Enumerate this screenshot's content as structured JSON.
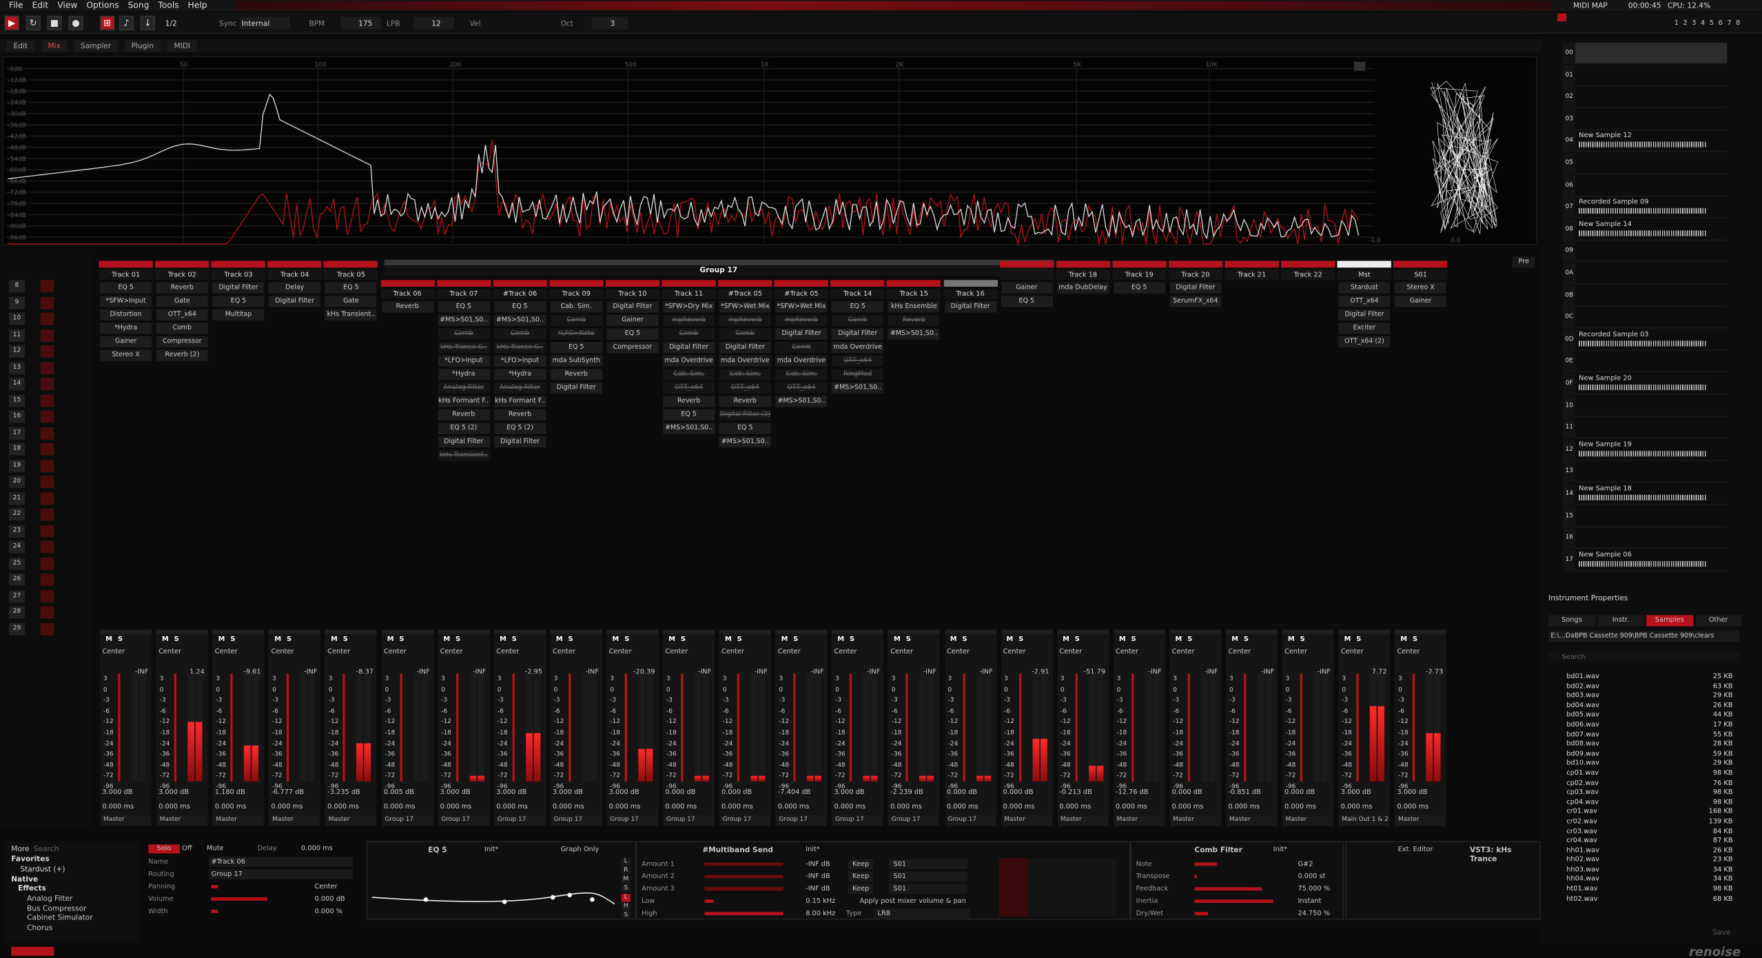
{
  "menu": [
    "File",
    "Edit",
    "View",
    "Options",
    "Song",
    "Tools",
    "Help"
  ],
  "top": {
    "pattern": "1/2",
    "sync_label": "Sync",
    "sync_value": "Internal",
    "bpm_label": "BPM",
    "bpm": "175",
    "lpb_label": "LPB",
    "lpb": "12",
    "vel_label": "Vel",
    "oct_label": "Oct",
    "oct": "3",
    "midi_map": "MIDI MAP",
    "time": "00:00:45",
    "cpu": "CPU: 12.4%",
    "tracks_vis": [
      "1",
      "2",
      "3",
      "4",
      "5",
      "6",
      "7",
      "8"
    ]
  },
  "tabs": [
    "Edit",
    "Mix",
    "Sampler",
    "Plugin",
    "MIDI"
  ],
  "spectrum": {
    "freq_labels": [
      "50",
      "100",
      "200",
      "500",
      "1K",
      "2K",
      "5K",
      "10K"
    ],
    "db_labels": [
      "-6dB",
      "-12dB",
      "-18dB",
      "-24dB",
      "-30dB",
      "-36dB",
      "-42dB",
      "-48dB",
      "-54dB",
      "-60dB",
      "-66dB",
      "-72dB",
      "-78dB",
      "-84dB",
      "-90dB",
      "-96dB"
    ],
    "scope_l": "-1.0",
    "scope_r": "0.0"
  },
  "seq": [
    "8",
    "9",
    "10",
    "11",
    "12",
    "13",
    "14",
    "15",
    "16",
    "17",
    "18",
    "19",
    "20",
    "21",
    "22",
    "23",
    "24",
    "25",
    "26",
    "27",
    "28",
    "29"
  ],
  "channels": [
    {
      "name": "Track 01",
      "devices": [
        "EQ 5",
        "*SFW>Input",
        "Distortion",
        "*Hydra",
        "Gainer",
        "Stereo X"
      ],
      "pan": "Center",
      "peak": "-INF",
      "db": "3.000 dB",
      "delay": "0.000 ms",
      "route": "Master"
    },
    {
      "name": "Track 02",
      "devices": [
        "Reverb",
        "Gate",
        "OTT_x64",
        "Comb",
        "Compressor",
        "Reverb (2)"
      ],
      "pan": "Center",
      "peak": "1.24",
      "db": "3.000 dB",
      "delay": "0.000 ms",
      "route": "Master"
    },
    {
      "name": "Track 03",
      "devices": [
        "Digital Filter",
        "EQ 5",
        "Multitap"
      ],
      "pan": "Center",
      "peak": "-9.61",
      "db": "1.180 dB",
      "delay": "0.000 ms",
      "route": "Master"
    },
    {
      "name": "Track 04",
      "devices": [
        "Delay",
        "Digital Filter"
      ],
      "pan": "Center",
      "peak": "-INF",
      "db": "-6.777 dB",
      "delay": "0.000 ms",
      "route": "Master"
    },
    {
      "name": "Track 05",
      "devices": [
        "EQ 5",
        "Gate",
        "kHs Transient.."
      ],
      "pan": "Center",
      "peak": "-8.37",
      "db": "-3.235 dB",
      "delay": "0.000 ms",
      "route": "Master"
    },
    {
      "name": "Track 06",
      "devices": [
        "Reverb"
      ],
      "pan": "Center",
      "peak": "-INF",
      "db": "0.005 dB",
      "delay": "0.000 ms",
      "route": "Group 17"
    },
    {
      "name": "Track 07",
      "devices": [
        "EQ 5",
        "#MS>S01,S0..",
        "Comb",
        "kHs Trance G..",
        "*LFO>Input",
        "*Hydra",
        "Analog Filter",
        "kHs Formant F..",
        "Reverb",
        "EQ 5 (2)",
        "Digital Filter",
        "kHs Transient.."
      ],
      "pan": "Center",
      "peak": "-INF",
      "db": "3.000 dB",
      "delay": "0.000 ms",
      "route": "Group 17"
    },
    {
      "name": "#Track 06",
      "devices": [
        "EQ 5",
        "#MS>S01,S0..",
        "Comb",
        "kHs Trance G..",
        "*LFO>Input",
        "*Hydra",
        "Analog Filter",
        "kHs Formant F..",
        "Reverb",
        "EQ 5 (2)",
        "Digital Filter"
      ],
      "pan": "Center",
      "peak": "-2.95",
      "db": "3.000 dB",
      "delay": "0.000 ms",
      "route": "Group 17"
    },
    {
      "name": "Track 09",
      "devices": [
        "Cab. Sim.",
        "Comb",
        "*LFO>Note",
        "EQ 5",
        "mda SubSynth",
        "Reverb",
        "Digital Filter"
      ],
      "pan": "Center",
      "peak": "-INF",
      "db": "3.000 dB",
      "delay": "0.000 ms",
      "route": "Group 17"
    },
    {
      "name": "Track 10",
      "devices": [
        "Digital Filter",
        "Gainer",
        "EQ 5",
        "Compressor"
      ],
      "pan": "Center",
      "peak": "-20.39",
      "db": "3.000 dB",
      "delay": "0.000 ms",
      "route": "Group 17"
    },
    {
      "name": "Track 11",
      "devices": [
        "*SFW>Dry Mix",
        "mpReverb",
        "Comb",
        "Digital Filter",
        "mda Overdrive",
        "Cab. Sim.",
        "OTT_x64",
        "Reverb",
        "EQ 5",
        "#MS>S01,S0.."
      ],
      "pan": "Center",
      "peak": "-INF",
      "db": "0.000 dB",
      "delay": "0.000 ms",
      "route": "Group 17"
    },
    {
      "name": "#Track 05",
      "devices": [
        "*SFW>Wet Mix",
        "mpReverb",
        "Comb",
        "Digital Filter",
        "mda Overdrive",
        "Cab. Sim.",
        "OTT_x64",
        "Reverb",
        "Digital Filter (2)",
        "EQ 5",
        "#MS>S01,S0.."
      ],
      "pan": "Center",
      "peak": "-INF",
      "db": "0.000 dB",
      "delay": "0.000 ms",
      "route": "Group 17"
    },
    {
      "name": "#Track 05",
      "devices": [
        "*SFW>Wet Mix",
        "mpReverb",
        "Digital Filter",
        "Comb",
        "mda Overdrive",
        "Cab. Sim.",
        "OTT_x64",
        "#MS>S01,S0.."
      ],
      "pan": "Center",
      "peak": "-INF",
      "db": "-7.404 dB",
      "delay": "0.000 ms",
      "route": "Group 17"
    },
    {
      "name": "Track 14",
      "devices": [
        "EQ 5",
        "Comb",
        "Digital Filter",
        "mda Overdrive",
        "OTT_x64",
        "RingMod",
        "#MS>S01,S0.."
      ],
      "pan": "Center",
      "peak": "-INF",
      "db": "3.000 dB",
      "delay": "0.000 ms",
      "route": "Group 17"
    },
    {
      "name": "Track 15",
      "devices": [
        "kHs Ensemble",
        "Reverb",
        "#MS>S01,S0.."
      ],
      "pan": "Center",
      "peak": "-INF",
      "db": "-2.239 dB",
      "delay": "0.000 ms",
      "route": "Group 17"
    },
    {
      "name": "Track 16",
      "devices": [
        "Digital Filter"
      ],
      "pan": "Center",
      "peak": "-INF",
      "db": "0.000 dB",
      "delay": "0.000 ms",
      "route": "Group 17"
    },
    {
      "name": "",
      "devices": [
        "Gainer",
        "EQ 5"
      ],
      "pan": "Center",
      "peak": "-2.91",
      "db": "0.000 dB",
      "delay": "0.000 ms",
      "route": "Master"
    },
    {
      "name": "Track 18",
      "devices": [
        "mda DubDelay"
      ],
      "pan": "Center",
      "peak": "-51.79",
      "db": "-0.213 dB",
      "delay": "0.000 ms",
      "route": "Master"
    },
    {
      "name": "Track 19",
      "devices": [
        "EQ 5"
      ],
      "pan": "Center",
      "peak": "-INF",
      "db": "-12.76 dB",
      "delay": "0.000 ms",
      "route": "Master"
    },
    {
      "name": "Track 20",
      "devices": [
        "Digital Filter",
        "SerumFX_x64"
      ],
      "pan": "Center",
      "peak": "-INF",
      "db": "0.000 dB",
      "delay": "0.000 ms",
      "route": "Master"
    },
    {
      "name": "Track 21",
      "devices": [],
      "pan": "Center",
      "peak": "-INF",
      "db": "-0.851 dB",
      "delay": "0.000 ms",
      "route": "Master"
    },
    {
      "name": "Track 22",
      "devices": [],
      "pan": "Center",
      "peak": "-INF",
      "db": "0.000 dB",
      "delay": "0.000 ms",
      "route": "Master"
    },
    {
      "name": "Mst",
      "devices": [
        "Stardust",
        "OTT_x64",
        "Digital Filter",
        "Exciter",
        "OTT_x64 (2)"
      ],
      "pan": "Center",
      "peak": "7.72",
      "db": "3.000 dB",
      "delay": "0.000 ms",
      "route": "Main Out 1 & 2"
    },
    {
      "name": "S01",
      "devices": [
        "Stereo X",
        "Gainer"
      ],
      "pan": "Center",
      "peak": "-2.73",
      "db": "3.000 dB",
      "delay": "0.000 ms",
      "route": "Master"
    }
  ],
  "group_label": "Group 17",
  "meter_scale": [
    "3",
    "0",
    "-3",
    "-6",
    "-12",
    "-18",
    "-24",
    "-36",
    "-48",
    "-72",
    "-96"
  ],
  "pre_label": "Pre",
  "instruments": [
    {
      "num": "00",
      "name": ""
    },
    {
      "num": "01",
      "name": ""
    },
    {
      "num": "02",
      "name": ""
    },
    {
      "num": "03",
      "name": ""
    },
    {
      "num": "04",
      "name": "New Sample 12"
    },
    {
      "num": "05",
      "name": ""
    },
    {
      "num": "06",
      "name": ""
    },
    {
      "num": "07",
      "name": "Recorded Sample 09"
    },
    {
      "num": "08",
      "name": "New Sample 14"
    },
    {
      "num": "09",
      "name": ""
    },
    {
      "num": "0A",
      "name": ""
    },
    {
      "num": "0B",
      "name": ""
    },
    {
      "num": "0C",
      "name": ""
    },
    {
      "num": "0D",
      "name": "Recorded Sample 03"
    },
    {
      "num": "0E",
      "name": ""
    },
    {
      "num": "0F",
      "name": "New Sample 20"
    },
    {
      "num": "10",
      "name": ""
    },
    {
      "num": "11",
      "name": ""
    },
    {
      "num": "12",
      "name": "New Sample 19"
    },
    {
      "num": "13",
      "name": ""
    },
    {
      "num": "14",
      "name": "New Sample 18"
    },
    {
      "num": "15",
      "name": ""
    },
    {
      "num": "16",
      "name": ""
    },
    {
      "num": "17",
      "name": "New Sample 06"
    }
  ],
  "inst_props": "Instrument Properties",
  "browser": {
    "tabs": [
      "Songs",
      "Instr.",
      "Samples",
      "Other"
    ],
    "path": "E:\\...DaBPB Cassette 909\\BPB Cassette 909\\clears",
    "search_placeholder": "Search",
    "files": [
      [
        "bd01.wav",
        "25 KB"
      ],
      [
        "bd02.wav",
        "63 KB"
      ],
      [
        "bd03.wav",
        "29 KB"
      ],
      [
        "bd04.wav",
        "26 KB"
      ],
      [
        "bd05.wav",
        "44 KB"
      ],
      [
        "bd06.wav",
        "17 KB"
      ],
      [
        "bd07.wav",
        "55 KB"
      ],
      [
        "bd08.wav",
        "28 KB"
      ],
      [
        "bd09.wav",
        "59 KB"
      ],
      [
        "bd10.wav",
        "29 KB"
      ],
      [
        "cp01.wav",
        "98 KB"
      ],
      [
        "cp02.wav",
        "76 KB"
      ],
      [
        "cp03.wav",
        "98 KB"
      ],
      [
        "cp04.wav",
        "98 KB"
      ],
      [
        "cr01.wav",
        "168 KB"
      ],
      [
        "cr02.wav",
        "139 KB"
      ],
      [
        "cr03.wav",
        "84 KB"
      ],
      [
        "cr04.wav",
        "87 KB"
      ],
      [
        "hh01.wav",
        "26 KB"
      ],
      [
        "hh02.wav",
        "23 KB"
      ],
      [
        "hh03.wav",
        "34 KB"
      ],
      [
        "hh04.wav",
        "34 KB"
      ],
      [
        "ht01.wav",
        "98 KB"
      ],
      [
        "ht02.wav",
        "68 KB"
      ]
    ],
    "save": "Save"
  },
  "bottom": {
    "more": "More",
    "search": "Search",
    "favorites": "Favorites",
    "fav_item": "Stardust (+)",
    "native": "Native",
    "effects": "Effects",
    "effect_items": [
      "Analog Filter",
      "Bus Compressor",
      "Cabinet Simulator",
      "Chorus"
    ],
    "track": {
      "solo": "Solo",
      "off": "Off",
      "mute": "Mute",
      "delay_label": "Delay",
      "delay": "0.000 ms",
      "name_label": "Name",
      "name": "#Track 06",
      "routing_label": "Routing",
      "routing": "Group 17",
      "panning_label": "Panning",
      "panning": "Center",
      "volume_label": "Volume",
      "volume": "0.000 dB",
      "width_label": "Width",
      "width": "0.000 %"
    },
    "eq": {
      "title": "EQ 5",
      "preset": "Init*",
      "mode": "Graph Only",
      "buttons": [
        "L",
        "R",
        "M",
        "S",
        "L",
        "H",
        "S"
      ],
      "ticks": [
        "100",
        "1K",
        "10K"
      ]
    },
    "ms": {
      "title": "#Multiband Send",
      "preset": "Init*",
      "rows": [
        [
          "Amount 1",
          "-INF dB",
          "Keep",
          "S01"
        ],
        [
          "Amount 2",
          "-INF dB",
          "Keep",
          "S01"
        ],
        [
          "Amount 3",
          "-INF dB",
          "Keep",
          "S01"
        ],
        [
          "Low",
          "0.15 kHz",
          "",
          ""
        ],
        [
          "High",
          "8.00 kHz",
          "",
          ""
        ]
      ],
      "apply": "Apply post mixer volume & pan",
      "type_label": "Type",
      "type": "LR8",
      "ticks": [
        "100",
        "1K",
        "10K"
      ]
    },
    "comb": {
      "title": "Comb Filter",
      "preset": "Init*",
      "rows": [
        [
          "Note",
          "G#2"
        ],
        [
          "Transpose",
          "0.000 st"
        ],
        [
          "Feedback",
          "75.000 %"
        ],
        [
          "Inertia",
          "Instant"
        ],
        [
          "Dry/Wet",
          "24.750 %"
        ]
      ]
    },
    "vst": {
      "ext": "Ext. Editor",
      "title": "VST3: kHs Trance"
    }
  },
  "logo": "renoise"
}
